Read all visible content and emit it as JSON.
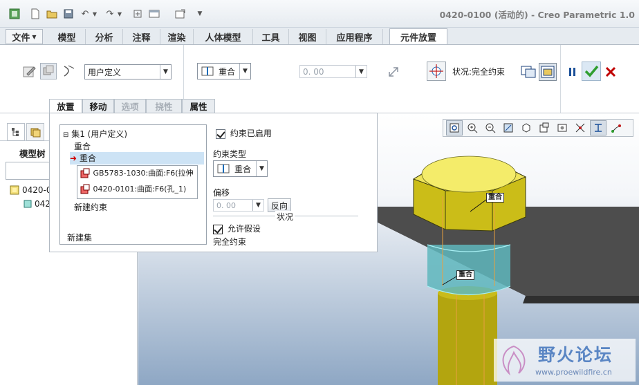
{
  "window": {
    "title": "0420-0100 (活动的) - Creo Parametric 1.0"
  },
  "ribbon_tabs": [
    {
      "label": "文件",
      "has_menu": true
    },
    {
      "label": "模型"
    },
    {
      "label": "分析"
    },
    {
      "label": "注释"
    },
    {
      "label": "渲染"
    },
    {
      "label": "人体模型"
    },
    {
      "label": "工具"
    },
    {
      "label": "视图"
    },
    {
      "label": "应用程序"
    },
    {
      "label": "元件放置",
      "active": true
    }
  ],
  "ribbon": {
    "set_type_select": "用户定义",
    "constraint_type_select": "重合",
    "offset_value": "0. 00",
    "status_label": "状况:完全约束"
  },
  "sub_tabs": [
    {
      "label": "放置",
      "active": true
    },
    {
      "label": "移动"
    },
    {
      "label": "选项",
      "disabled": true
    },
    {
      "label": "挠性",
      "disabled": true
    },
    {
      "label": "属性"
    }
  ],
  "left_panel": {
    "title": "模型树",
    "tree": [
      "0420-0",
      "042"
    ]
  },
  "placement": {
    "set_label": "集1 (用户定义)",
    "constraint_1": "重合",
    "constraint_2": "重合",
    "ref_1": "GB5783-1030:曲面:F6(拉伸",
    "ref_2": "0420-0101:曲面:F6(孔_1)",
    "new_constraint": "新建约束",
    "new_set": "新建集",
    "enabled_label": "约束已启用",
    "type_label": "约束类型",
    "type_value": "重合",
    "offset_label": "偏移",
    "offset_value": "0. 00",
    "flip_button": "反向",
    "status_group": "状况",
    "allow_assumptions": "允许假设",
    "status_value": "完全约束"
  },
  "model_tags": {
    "tag_1": "重合",
    "tag_2": "重合"
  },
  "watermark": {
    "title": "野火论坛",
    "url": "www.proewildfire.cn"
  },
  "colors": {
    "accent_green": "#2f9e2f",
    "close_red": "#c00000",
    "bolt_yellow": "#d8c918",
    "selection": "#cde3f5"
  }
}
